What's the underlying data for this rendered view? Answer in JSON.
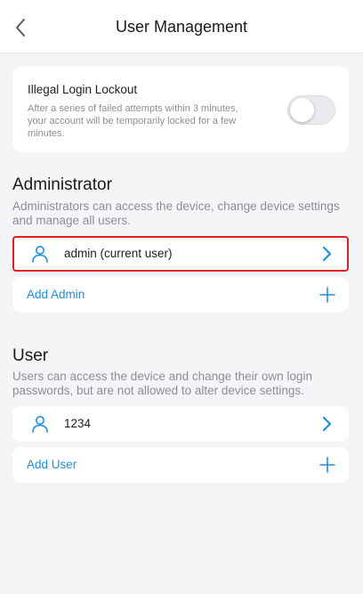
{
  "header": {
    "title": "User Management",
    "back_icon": "chevron-left-icon"
  },
  "lockout": {
    "title": "Illegal Login Lockout",
    "description": "After a series of failed attempts within 3 minutes, your account will be temporarily locked for a few minutes.",
    "enabled": false
  },
  "administrator": {
    "title": "Administrator",
    "description": "Administrators can access the device, change device settings and manage all users.",
    "users": [
      {
        "name": "admin (current user)",
        "icon": "user-icon"
      }
    ],
    "add_label": "Add Admin"
  },
  "user": {
    "title": "User",
    "description": "Users can access the device and change their own login passwords, but are not allowed to alter device settings.",
    "users": [
      {
        "name": "1234",
        "icon": "user-icon"
      }
    ],
    "add_label": "Add User"
  },
  "colors": {
    "accent": "#1e8fd6",
    "highlight_border": "#e02020",
    "background": "#f4f5f7"
  }
}
